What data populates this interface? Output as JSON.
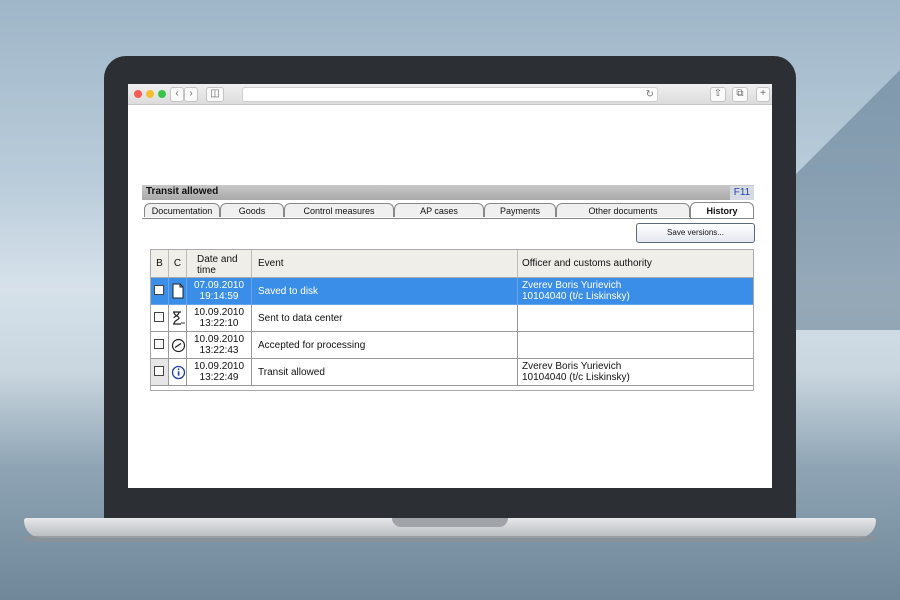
{
  "app": {
    "title": "Transit allowed",
    "shortcut": "F11",
    "tabs": [
      {
        "label": "Documentation",
        "active": false
      },
      {
        "label": "Goods",
        "active": false
      },
      {
        "label": "Control measures",
        "active": false
      },
      {
        "label": "AP cases",
        "active": false
      },
      {
        "label": "Payments",
        "active": false
      },
      {
        "label": "Other documents",
        "active": false
      },
      {
        "label": "History",
        "active": true
      }
    ],
    "save_versions_label": "Save versions..."
  },
  "table": {
    "columns": {
      "b": "B",
      "c": "C",
      "datetime_line1": "Date and",
      "datetime_line2": "time",
      "event": "Event",
      "officer": "Officer and customs authority"
    },
    "rows": [
      {
        "icon": "document-icon",
        "date": "07.09.2010",
        "time": "19:14:59",
        "event": "Saved to disk",
        "officer_name": "Zverev Boris Yurievich",
        "officer_authority": "10104040 (t/c Liskinsky)",
        "selected": true
      },
      {
        "icon": "hourglass-icon",
        "date": "10.09.2010",
        "time": "13:22:10",
        "event": "Sent to data center",
        "officer_name": "",
        "officer_authority": "",
        "selected": false
      },
      {
        "icon": "gauge-icon",
        "date": "10.09.2010",
        "time": "13:22:43",
        "event": "Accepted for processing",
        "officer_name": "",
        "officer_authority": "",
        "selected": false
      },
      {
        "icon": "info-icon",
        "date": "10.09.2010",
        "time": "13:22:49",
        "event": "Transit allowed",
        "officer_name": "Zverev Boris Yurievich",
        "officer_authority": "10104040 (t/c Liskinsky)",
        "selected": false
      }
    ]
  },
  "colors": {
    "selection": "#3b8ee8",
    "shortcut_text": "#1f45a8"
  }
}
